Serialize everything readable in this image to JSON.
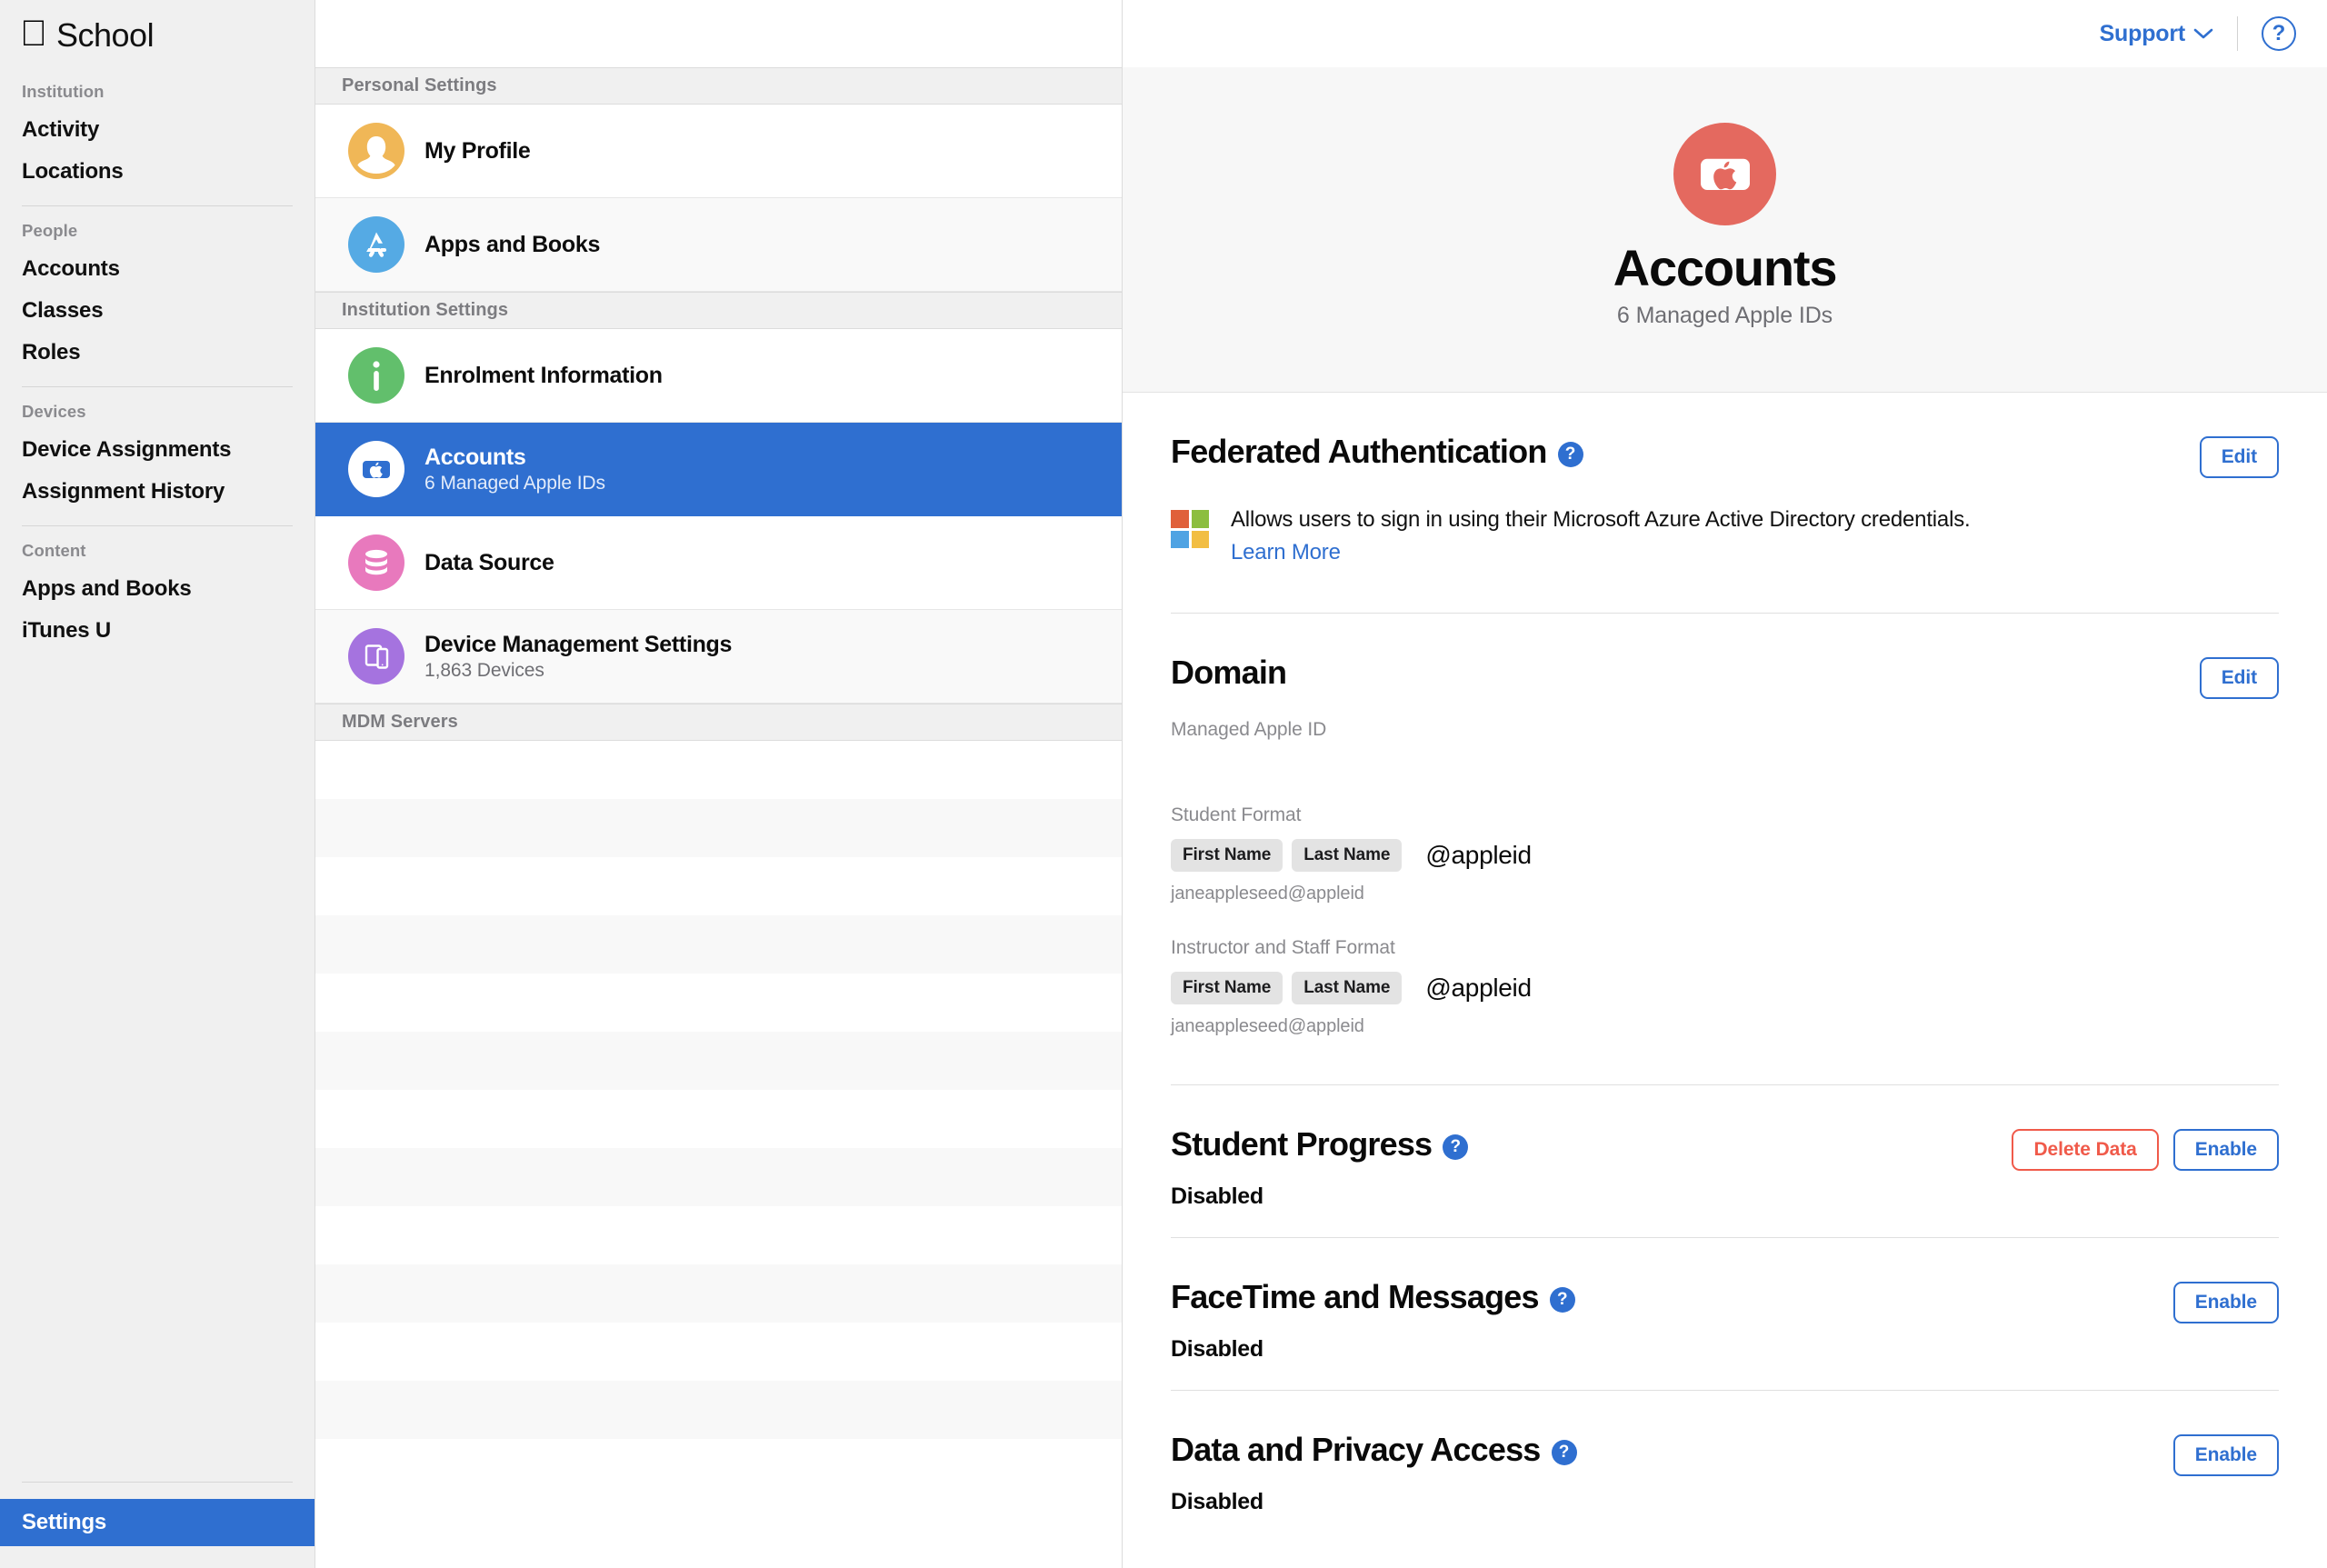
{
  "sidebar": {
    "brand": "School",
    "groups": [
      {
        "title": "Institution",
        "items": [
          {
            "label": "Activity"
          },
          {
            "label": "Locations"
          }
        ]
      },
      {
        "title": "People",
        "items": [
          {
            "label": "Accounts"
          },
          {
            "label": "Classes"
          },
          {
            "label": "Roles"
          }
        ]
      },
      {
        "title": "Devices",
        "items": [
          {
            "label": "Device Assignments"
          },
          {
            "label": "Assignment History"
          }
        ]
      },
      {
        "title": "Content",
        "items": [
          {
            "label": "Apps and Books"
          },
          {
            "label": "iTunes U"
          }
        ]
      }
    ],
    "settings_label": "Settings",
    "settings_accent": "#2f6fd0"
  },
  "settings_list": {
    "sections": [
      {
        "header": "Personal Settings",
        "rows": [
          {
            "title": "My Profile",
            "subtitle": "",
            "icon": "person-avatar-icon",
            "icon_color": "#f0b757",
            "selected": false
          },
          {
            "title": "Apps and Books",
            "subtitle": "",
            "icon": "app-store-icon",
            "icon_color": "#55aae4",
            "selected": false
          }
        ]
      },
      {
        "header": "Institution Settings",
        "rows": [
          {
            "title": "Enrolment Information",
            "subtitle": "",
            "icon": "info-icon",
            "icon_color": "#62bf6c",
            "selected": false
          },
          {
            "title": "Accounts",
            "subtitle": "6 Managed Apple IDs",
            "icon": "apple-id-card-icon",
            "icon_color": "#ffffff",
            "selected": true
          },
          {
            "title": "Data Source",
            "subtitle": "",
            "icon": "database-icon",
            "icon_color": "#e879bd",
            "selected": false
          },
          {
            "title": "Device Management Settings",
            "subtitle": "1,863 Devices",
            "icon": "devices-icon",
            "icon_color": "#a573df",
            "selected": false
          }
        ]
      },
      {
        "header": "MDM Servers",
        "rows": []
      }
    ]
  },
  "topbar": {
    "support_label": "Support",
    "chevron_icon": "chevron-down-icon",
    "help_icon": "question-mark-circle-icon",
    "help_glyph": "?",
    "accent": "#2f6fd0"
  },
  "hero": {
    "icon": "apple-id-card-icon",
    "icon_bg": "#e4695f",
    "title": "Accounts",
    "subtitle": "6 Managed Apple IDs"
  },
  "detail": {
    "federated": {
      "title": "Federated Authentication",
      "help_glyph": "?",
      "edit_label": "Edit",
      "description": "Allows users to sign in using their Microsoft Azure Active Directory credentials.",
      "learn_more_label": "Learn More",
      "logo_icon": "microsoft-logo-icon",
      "logo_colors": [
        "#e0603a",
        "#8cbe3f",
        "#4fa3e3",
        "#f2be43"
      ]
    },
    "domain": {
      "title": "Domain",
      "edit_label": "Edit",
      "managed_apple_id_label": "Managed Apple ID",
      "managed_apple_id_value": "",
      "student_format_label": "Student Format",
      "student_chips": [
        "First Name",
        "Last Name"
      ],
      "student_suffix": "@appleid",
      "student_example": "janeappleseed@appleid",
      "staff_format_label": "Instructor and Staff Format",
      "staff_chips": [
        "First Name",
        "Last Name"
      ],
      "staff_suffix": "@appleid",
      "staff_example": "janeappleseed@appleid"
    },
    "student_progress": {
      "title": "Student Progress",
      "help_glyph": "?",
      "status": "Disabled",
      "delete_label": "Delete Data",
      "enable_label": "Enable",
      "danger_color": "#f05a4a"
    },
    "facetime": {
      "title": "FaceTime and Messages",
      "help_glyph": "?",
      "status": "Disabled",
      "enable_label": "Enable"
    },
    "privacy": {
      "title": "Data and Privacy Access",
      "help_glyph": "?",
      "status": "Disabled",
      "enable_label": "Enable"
    }
  }
}
